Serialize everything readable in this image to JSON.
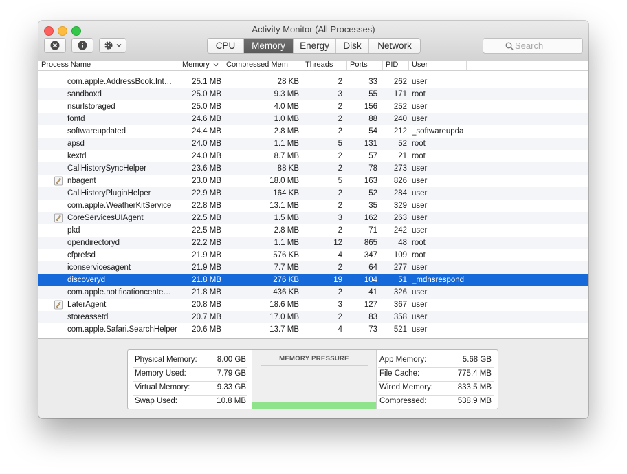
{
  "window": {
    "title": "Activity Monitor (All Processes)"
  },
  "toolbar": {
    "tabs": [
      {
        "label": "CPU",
        "active": false
      },
      {
        "label": "Memory",
        "active": true
      },
      {
        "label": "Energy",
        "active": false
      },
      {
        "label": "Disk",
        "active": false
      },
      {
        "label": "Network",
        "active": false
      }
    ],
    "search_placeholder": "Search"
  },
  "table": {
    "columns": [
      "Process Name",
      "Memory",
      "Compressed Mem",
      "Threads",
      "Ports",
      "PID",
      "User"
    ],
    "sort_column": "Memory",
    "rows": [
      {
        "name": "com.apple.AddressBook.Int…",
        "memory": "25.1 MB",
        "compressed": "28 KB",
        "threads": "2",
        "ports": "33",
        "pid": "262",
        "user": "user",
        "icon": false
      },
      {
        "name": "sandboxd",
        "memory": "25.0 MB",
        "compressed": "9.3 MB",
        "threads": "3",
        "ports": "55",
        "pid": "171",
        "user": "root",
        "icon": false
      },
      {
        "name": "nsurlstoraged",
        "memory": "25.0 MB",
        "compressed": "4.0 MB",
        "threads": "2",
        "ports": "156",
        "pid": "252",
        "user": "user",
        "icon": false
      },
      {
        "name": "fontd",
        "memory": "24.6 MB",
        "compressed": "1.0 MB",
        "threads": "2",
        "ports": "88",
        "pid": "240",
        "user": "user",
        "icon": false
      },
      {
        "name": "softwareupdated",
        "memory": "24.4 MB",
        "compressed": "2.8 MB",
        "threads": "2",
        "ports": "54",
        "pid": "212",
        "user": "_softwareupda",
        "icon": false
      },
      {
        "name": "apsd",
        "memory": "24.0 MB",
        "compressed": "1.1 MB",
        "threads": "5",
        "ports": "131",
        "pid": "52",
        "user": "root",
        "icon": false
      },
      {
        "name": "kextd",
        "memory": "24.0 MB",
        "compressed": "8.7 MB",
        "threads": "2",
        "ports": "57",
        "pid": "21",
        "user": "root",
        "icon": false
      },
      {
        "name": "CallHistorySyncHelper",
        "memory": "23.6 MB",
        "compressed": "88 KB",
        "threads": "2",
        "ports": "78",
        "pid": "273",
        "user": "user",
        "icon": false
      },
      {
        "name": "nbagent",
        "memory": "23.0 MB",
        "compressed": "18.0 MB",
        "threads": "5",
        "ports": "163",
        "pid": "826",
        "user": "user",
        "icon": true
      },
      {
        "name": "CallHistoryPluginHelper",
        "memory": "22.9 MB",
        "compressed": "164 KB",
        "threads": "2",
        "ports": "52",
        "pid": "284",
        "user": "user",
        "icon": false
      },
      {
        "name": "com.apple.WeatherKitService",
        "memory": "22.8 MB",
        "compressed": "13.1 MB",
        "threads": "2",
        "ports": "35",
        "pid": "329",
        "user": "user",
        "icon": false
      },
      {
        "name": "CoreServicesUIAgent",
        "memory": "22.5 MB",
        "compressed": "1.5 MB",
        "threads": "3",
        "ports": "162",
        "pid": "263",
        "user": "user",
        "icon": true
      },
      {
        "name": "pkd",
        "memory": "22.5 MB",
        "compressed": "2.8 MB",
        "threads": "2",
        "ports": "71",
        "pid": "242",
        "user": "user",
        "icon": false
      },
      {
        "name": "opendirectoryd",
        "memory": "22.2 MB",
        "compressed": "1.1 MB",
        "threads": "12",
        "ports": "865",
        "pid": "48",
        "user": "root",
        "icon": false
      },
      {
        "name": "cfprefsd",
        "memory": "21.9 MB",
        "compressed": "576 KB",
        "threads": "4",
        "ports": "347",
        "pid": "109",
        "user": "root",
        "icon": false
      },
      {
        "name": "iconservicesagent",
        "memory": "21.9 MB",
        "compressed": "7.7 MB",
        "threads": "2",
        "ports": "64",
        "pid": "277",
        "user": "user",
        "icon": false
      },
      {
        "name": "discoveryd",
        "memory": "21.8 MB",
        "compressed": "276 KB",
        "threads": "19",
        "ports": "104",
        "pid": "51",
        "user": "_mdnsrespond",
        "icon": false,
        "selected": true
      },
      {
        "name": "com.apple.notificationcente…",
        "memory": "21.8 MB",
        "compressed": "436 KB",
        "threads": "2",
        "ports": "41",
        "pid": "326",
        "user": "user",
        "icon": false
      },
      {
        "name": "LaterAgent",
        "memory": "20.8 MB",
        "compressed": "18.6 MB",
        "threads": "3",
        "ports": "127",
        "pid": "367",
        "user": "user",
        "icon": true
      },
      {
        "name": "storeassetd",
        "memory": "20.7 MB",
        "compressed": "17.0 MB",
        "threads": "2",
        "ports": "83",
        "pid": "358",
        "user": "user",
        "icon": false
      },
      {
        "name": "com.apple.Safari.SearchHelper",
        "memory": "20.6 MB",
        "compressed": "13.7 MB",
        "threads": "4",
        "ports": "73",
        "pid": "521",
        "user": "user",
        "icon": false
      }
    ]
  },
  "summary": {
    "left": [
      {
        "label": "Physical Memory:",
        "value": "8.00 GB"
      },
      {
        "label": "Memory Used:",
        "value": "7.79 GB"
      },
      {
        "label": "Virtual Memory:",
        "value": "9.33 GB"
      },
      {
        "label": "Swap Used:",
        "value": "10.8 MB"
      }
    ],
    "pressure_title": "MEMORY PRESSURE",
    "pressure_color": "#8fe38a",
    "right": [
      {
        "label": "App Memory:",
        "value": "5.68 GB"
      },
      {
        "label": "File Cache:",
        "value": "775.4 MB"
      },
      {
        "label": "Wired Memory:",
        "value": "833.5 MB"
      },
      {
        "label": "Compressed:",
        "value": "538.9 MB"
      }
    ]
  }
}
